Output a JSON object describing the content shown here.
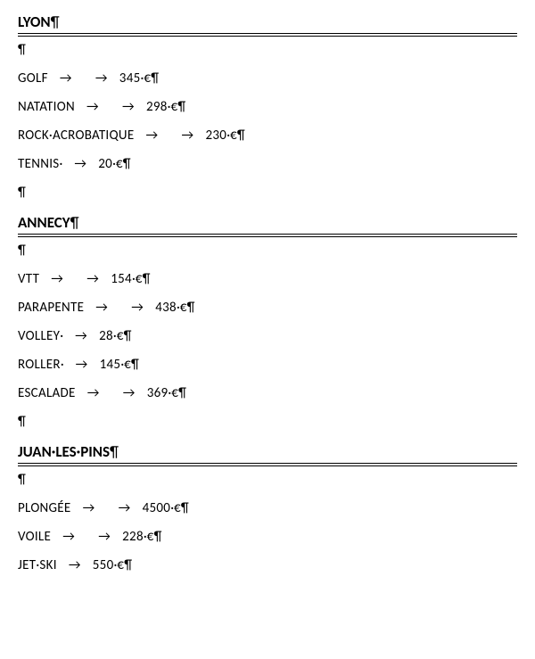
{
  "marks": {
    "pilcrow": "¶",
    "tab": "→",
    "dot": "·"
  },
  "sections": [
    {
      "title": "LYON",
      "rows": [
        {
          "name": "GOLF",
          "tabs_before": 2,
          "price": "345",
          "currency": "€",
          "trailing_dot": false
        },
        {
          "name": "NATATION",
          "tabs_before": 2,
          "price": "298",
          "currency": "€",
          "trailing_dot": false
        },
        {
          "name": "ROCK·ACROBATIQUE",
          "tabs_before": 2,
          "price": "230",
          "currency": "€",
          "trailing_dot": false
        },
        {
          "name": "TENNIS",
          "tabs_before": 1,
          "price": "20",
          "currency": "€",
          "trailing_dot": true
        }
      ]
    },
    {
      "title": "ANNECY",
      "rows": [
        {
          "name": "VTT",
          "tabs_before": 2,
          "price": "154",
          "currency": "€",
          "trailing_dot": false
        },
        {
          "name": "PARAPENTE",
          "tabs_before": 2,
          "price": "438",
          "currency": "€",
          "trailing_dot": false
        },
        {
          "name": "VOLLEY",
          "tabs_before": 1,
          "price": "28",
          "currency": "€",
          "trailing_dot": true
        },
        {
          "name": "ROLLER",
          "tabs_before": 1,
          "price": "145",
          "currency": "€",
          "trailing_dot": true
        },
        {
          "name": "ESCALADE",
          "tabs_before": 2,
          "price": "369",
          "currency": "€",
          "trailing_dot": false
        }
      ]
    },
    {
      "title": "JUAN·LES·PINS",
      "rows": [
        {
          "name": "PLONGÉE",
          "tabs_before": 2,
          "price": "4500",
          "currency": "€",
          "trailing_dot": false
        },
        {
          "name": "VOILE",
          "tabs_before": 2,
          "price": "228",
          "currency": "€",
          "trailing_dot": false
        },
        {
          "name": "JET·SKI",
          "tabs_before": 1,
          "price": "550",
          "currency": "€",
          "trailing_dot": false
        }
      ]
    }
  ]
}
